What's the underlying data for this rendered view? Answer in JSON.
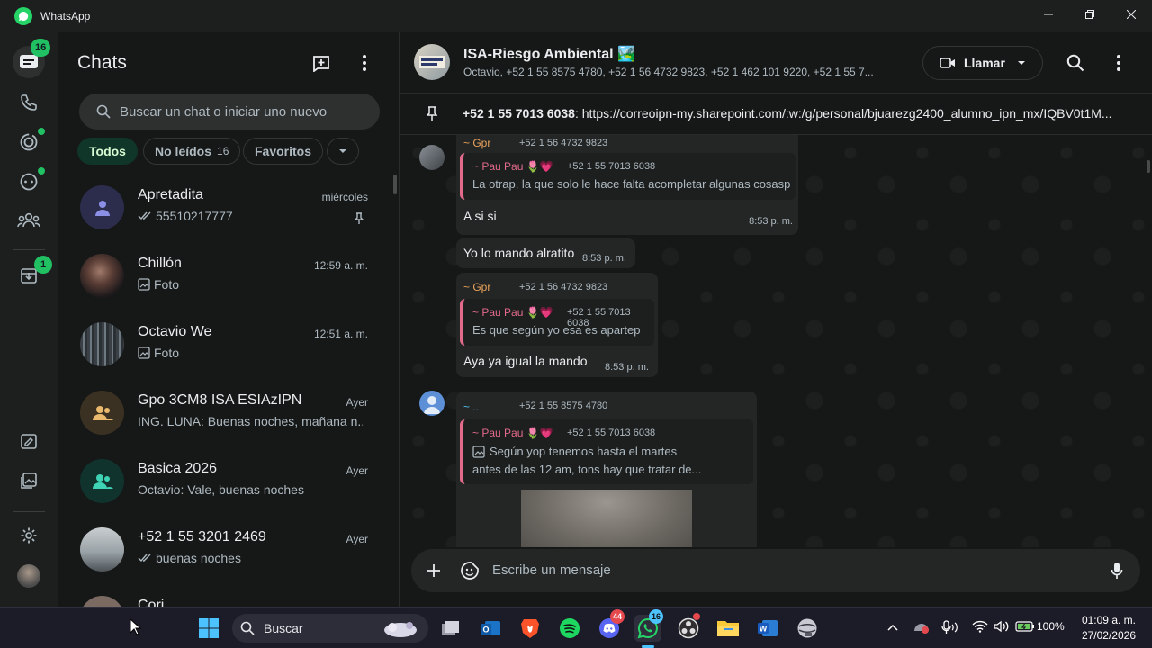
{
  "window": {
    "app_title": "WhatsApp",
    "minimize_icon": "minimize-icon",
    "maximize_icon": "restore-icon",
    "close_icon": "close-icon"
  },
  "rail": {
    "chats_badge": "16",
    "archived_badge": "1",
    "accent": "#21c063"
  },
  "chat_list": {
    "title": "Chats",
    "search_placeholder": "Buscar un chat o iniciar uno nuevo",
    "filters": [
      {
        "label": "Todos"
      },
      {
        "label": "No leídos",
        "count": "16"
      },
      {
        "label": "Favoritos"
      }
    ],
    "chats": [
      {
        "name": "Apretadita",
        "time": "miércoles",
        "preview": "55510217777",
        "status": "double-check",
        "pinned": true
      },
      {
        "name": "Chillón",
        "time": "12:59 a. m.",
        "preview": "Foto",
        "status": "photo"
      },
      {
        "name": "Octavio We",
        "time": "12:51 a. m.",
        "preview": "Foto",
        "status": "photo"
      },
      {
        "name": "Gpo 3CM8 ISA ESIAzIPN",
        "time": "Ayer",
        "preview": "ING. LUNA: Buenas noches, mañana n..."
      },
      {
        "name": "Basica 2026",
        "time": "Ayer",
        "preview": "Octavio: Vale, buenas noches"
      },
      {
        "name": "+52 1 55 3201 2469",
        "time": "Ayer",
        "preview": "buenas noches",
        "status": "double-check"
      },
      {
        "name": "Cori",
        "time": "",
        "preview": ""
      }
    ]
  },
  "conversation": {
    "group_name": "ISA-Riesgo Ambiental",
    "group_emoji": "🏞️",
    "members": "Octavio, +52 1 55 8575 4780, +52 1 56 4732 9823, +52 1 462 101 9220, +52 1 55 7...",
    "call_label": "Llamar",
    "pinned_sender": "+52 1 55 7013 6038",
    "pinned_text": ": https://correoipn-my.sharepoint.com/:w:/g/personal/bjuarezg2400_alumno_ipn_mx/IQBV0t1M...",
    "messages": [
      {
        "sender": "~ Gpr",
        "phone": "+52 1 56 4732 9823",
        "quote_name": "~ Pau Pau 🌷💗",
        "quote_phone": "+52 1 55 7013 6038",
        "quote_text": "La otrap, la que solo le hace falta acompletar algunas cosasp",
        "text": "A si si",
        "time": "8:53 p. m."
      },
      {
        "text": "Yo lo mando alratito",
        "time": "8:53 p. m."
      },
      {
        "sender": "~ Gpr",
        "phone": "+52 1 56 4732 9823",
        "quote_name": "~ Pau Pau 🌷💗",
        "quote_phone": "+52 1 55 7013 6038",
        "quote_text": "Es que según yo esa es apartep",
        "text": "Aya ya igual la mando",
        "time": "8:53 p. m."
      },
      {
        "sender": "~ ..",
        "phone": "+52 1 55 8575 4780",
        "quote_name": "~ Pau Pau 🌷💗",
        "quote_phone": "+52 1 55 7013 6038",
        "quote_text_1": "Según yop tenemos hasta el martes",
        "quote_text_2": "antes de las 12 am, tons hay que tratar de..."
      }
    ],
    "composer_placeholder": "Escribe un mensaje"
  },
  "taskbar": {
    "search_placeholder": "Buscar",
    "discord_badge": "44",
    "whatsapp_badge": "16",
    "battery": "100%",
    "time": "01:09 a. m.",
    "date": "27/02/2026"
  }
}
